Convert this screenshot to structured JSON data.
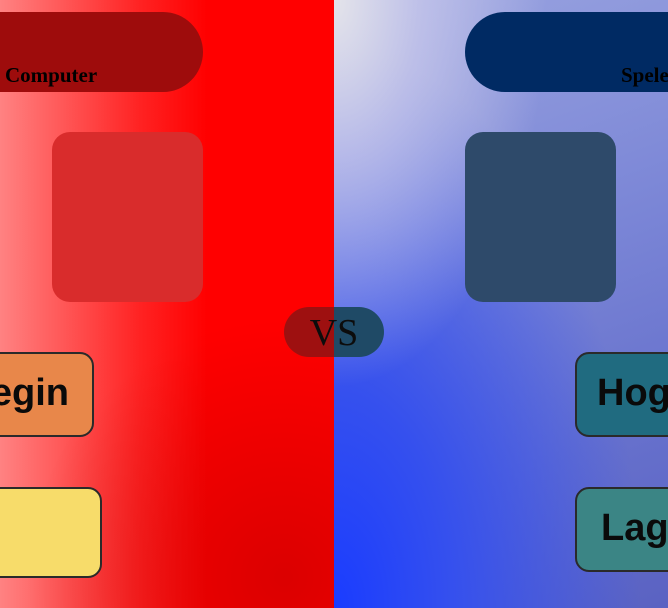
{
  "left_player": {
    "name": "Computer",
    "color": "#ff0000",
    "header_color": "#9e0c0c",
    "card_color": "#d92c2c",
    "buttons": [
      {
        "label": "Begin",
        "color": "#e8874a"
      },
      {
        "label": "",
        "color": "#f7dc6a"
      }
    ]
  },
  "right_player": {
    "name": "Speler",
    "color": "#3550ee",
    "header_color": "#002a63",
    "card_color": "#2e4a6a",
    "buttons": [
      {
        "label": "Hoger",
        "color": "#206b80"
      },
      {
        "label": "Lager",
        "color": "#3b8585"
      }
    ]
  },
  "vs": {
    "label": "VS"
  }
}
